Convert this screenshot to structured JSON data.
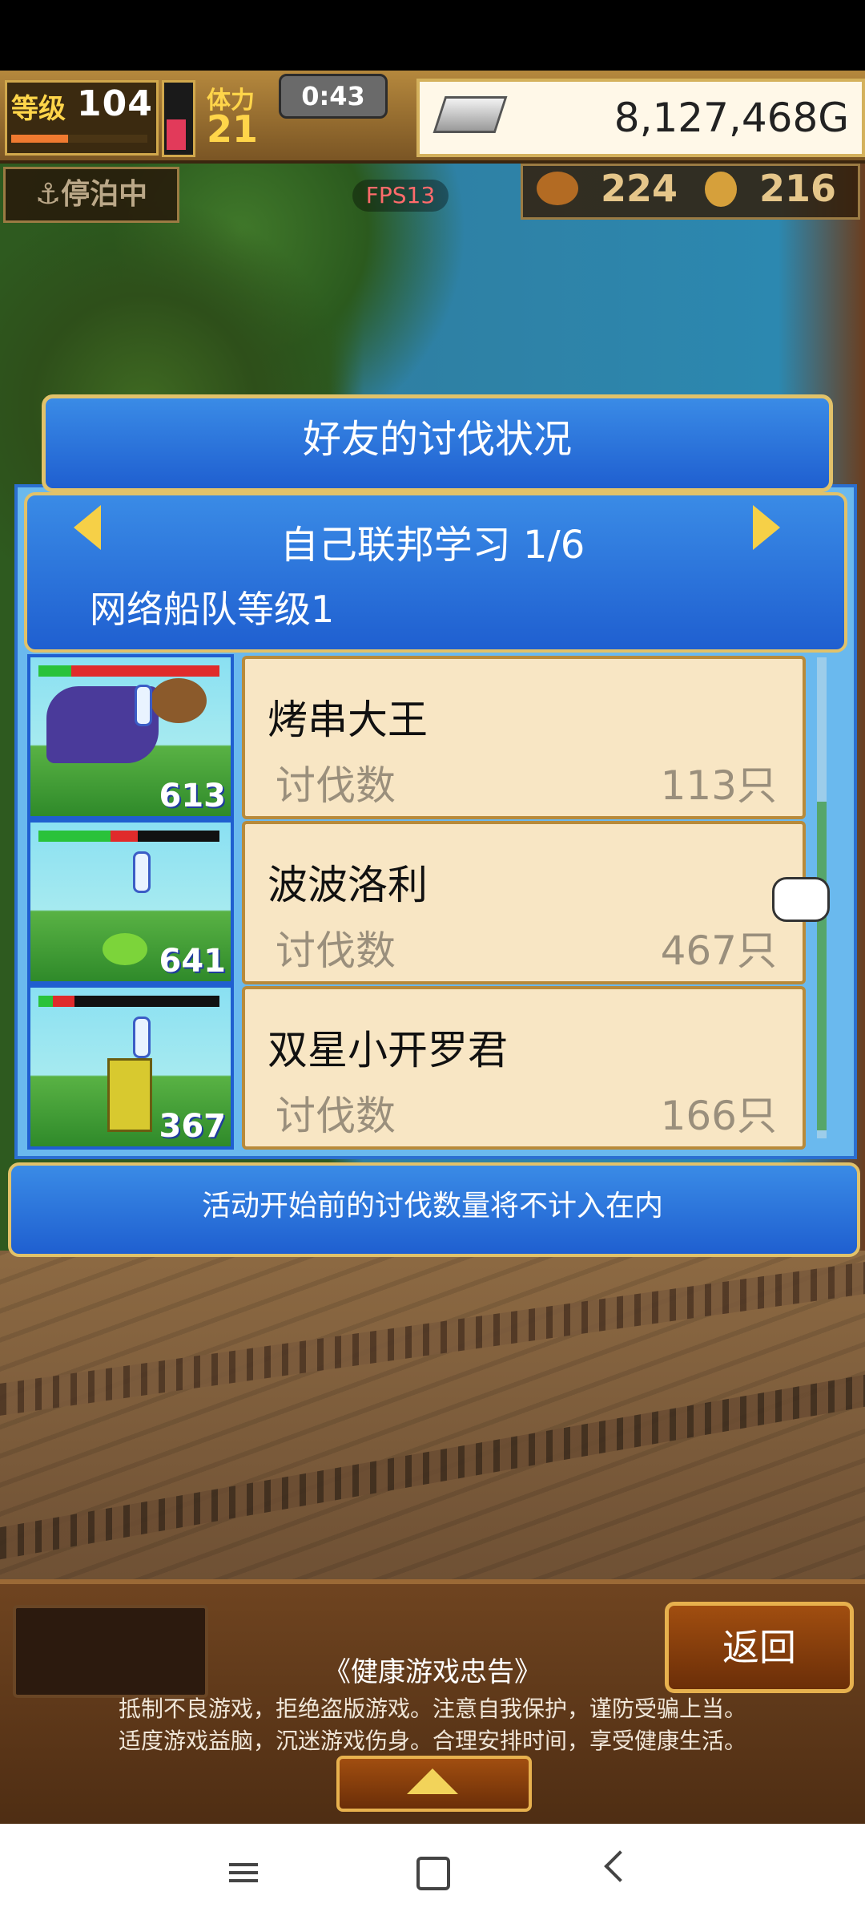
{
  "hud": {
    "level_label": "等级",
    "level_value": "104",
    "exp_progress": 0.42,
    "stamina_label": "体力",
    "stamina_value": "21",
    "stamina_progress": 0.45,
    "timer": "0:43",
    "gold": "8,127,468G",
    "anchor_status": "停泊中",
    "fps": "FPS13",
    "resource_1": "224",
    "resource_2": "216"
  },
  "panel": {
    "title": "好友的讨伐状况",
    "group_title": "自己联邦学习 1/6",
    "fleet_level": "网络船队等级1",
    "notice": "活动开始前的讨伐数量将不计入在内"
  },
  "entries": [
    {
      "thumb_number": "613",
      "name": "烤串大王",
      "label": "讨伐数",
      "count": "113只",
      "hp_green": 0.18,
      "hp_red": 0.82
    },
    {
      "thumb_number": "641",
      "name": "波波洛利",
      "label": "讨伐数",
      "count": "467只",
      "hp_green": 0.4,
      "hp_red": 0.15
    },
    {
      "thumb_number": "367",
      "name": "双星小开罗君",
      "label": "讨伐数",
      "count": "166只",
      "hp_green": 0.08,
      "hp_red": 0.12
    }
  ],
  "bottom": {
    "back_label": "返回",
    "health_title": "《健康游戏忠告》",
    "health_line1": "抵制不良游戏，拒绝盗版游戏。注意自我保护，谨防受骗上当。",
    "health_line2": "适度游戏益脑，沉迷游戏伤身。合理安排时间，享受健康生活。"
  },
  "icons": {
    "left_arrow": "left-arrow-icon",
    "right_arrow": "right-arrow-icon",
    "gold": "silver-bar-icon",
    "anchor": "anchor-icon",
    "pointer": "hand-pointer-icon",
    "up": "up-arrow-icon"
  },
  "colors": {
    "panel_blue": "#1f5fd0",
    "card_bg": "#f8e6c4",
    "gold_border": "#e1c26a"
  }
}
